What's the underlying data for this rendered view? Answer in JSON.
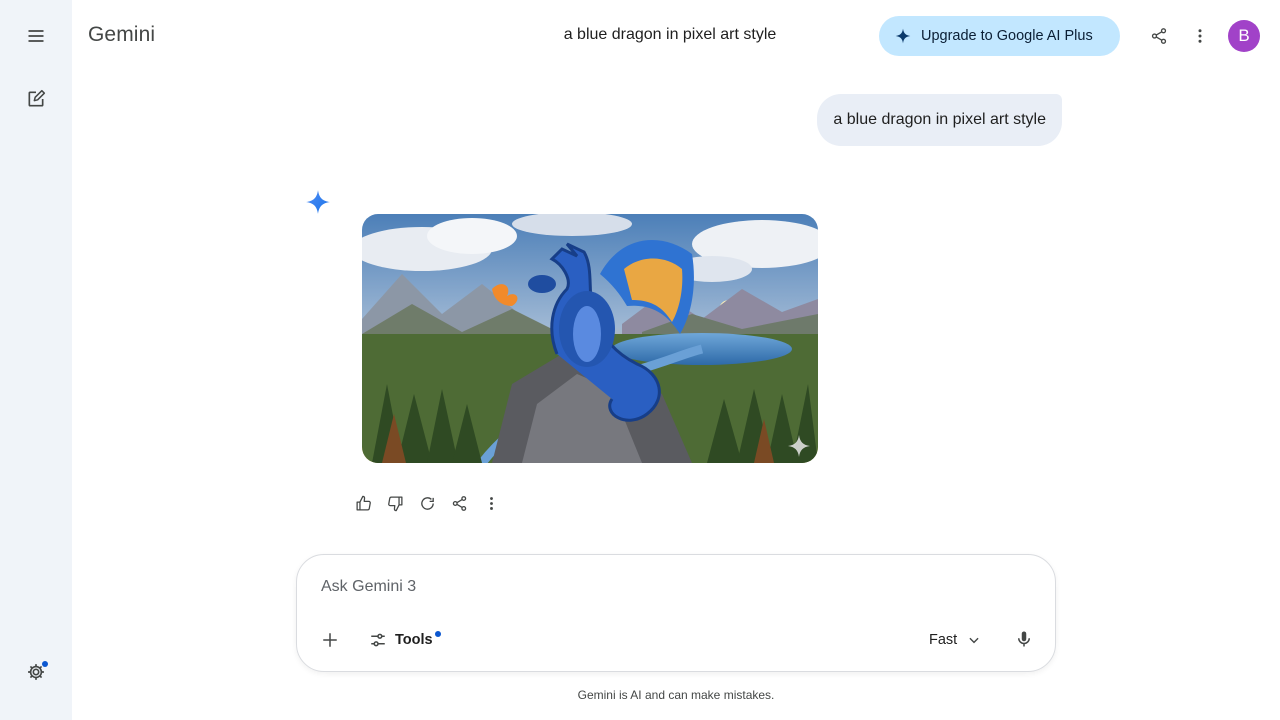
{
  "app": {
    "title": "Gemini"
  },
  "header": {
    "chat_title": "a blue dragon in pixel art style",
    "upgrade_label": "Upgrade to Google AI Plus",
    "avatar_initial": "B"
  },
  "conversation": {
    "user_message": "a blue dragon in pixel art style"
  },
  "composer": {
    "placeholder": "Ask Gemini 3",
    "tools_label": "Tools",
    "mode_label": "Fast"
  },
  "footer": {
    "disclaimer": "Gemini is AI and can make mistakes."
  },
  "colors": {
    "rail_bg": "#f0f4f9",
    "upgrade_bg": "#c2e7ff",
    "avatar_bg": "#a142c8",
    "user_bubble_bg": "#e9eef6",
    "accent_blue": "#0b57d0"
  },
  "icons": {
    "rail": [
      "menu-icon",
      "new-chat-icon",
      "settings-icon"
    ],
    "header": [
      "sparkle-icon",
      "share-icon",
      "more-vert-icon"
    ],
    "response_actions": [
      "thumb-up-icon",
      "thumb-down-icon",
      "redo-icon",
      "share-icon",
      "more-vert-icon"
    ],
    "composer": [
      "plus-icon",
      "tools-icon",
      "chevron-down-icon",
      "mic-icon"
    ]
  }
}
